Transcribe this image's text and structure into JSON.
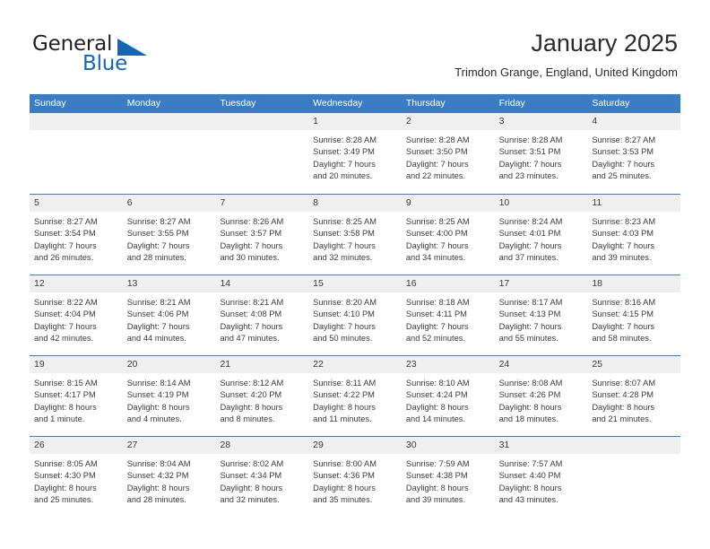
{
  "brand": {
    "word_one": "General",
    "word_two": "Blue",
    "triangle_icon": "brand-triangle-icon",
    "accent_color": "#1567b2"
  },
  "header": {
    "title": "January 2025",
    "subtitle": "Trimdon Grange, England, United Kingdom"
  },
  "colors": {
    "header_blue": "#3b7dc4",
    "day_strip_gray": "#efefef",
    "text": "#3a3a3a"
  },
  "calendar": {
    "weekdays": [
      "Sunday",
      "Monday",
      "Tuesday",
      "Wednesday",
      "Thursday",
      "Friday",
      "Saturday"
    ],
    "weeks": [
      [
        {
          "day": "",
          "empty": true,
          "lines": []
        },
        {
          "day": "",
          "empty": true,
          "lines": []
        },
        {
          "day": "",
          "empty": true,
          "lines": []
        },
        {
          "day": "1",
          "empty": false,
          "lines": [
            "Sunrise: 8:28 AM",
            "Sunset: 3:49 PM",
            "Daylight: 7 hours",
            "and 20 minutes."
          ]
        },
        {
          "day": "2",
          "empty": false,
          "lines": [
            "Sunrise: 8:28 AM",
            "Sunset: 3:50 PM",
            "Daylight: 7 hours",
            "and 22 minutes."
          ]
        },
        {
          "day": "3",
          "empty": false,
          "lines": [
            "Sunrise: 8:28 AM",
            "Sunset: 3:51 PM",
            "Daylight: 7 hours",
            "and 23 minutes."
          ]
        },
        {
          "day": "4",
          "empty": false,
          "lines": [
            "Sunrise: 8:27 AM",
            "Sunset: 3:53 PM",
            "Daylight: 7 hours",
            "and 25 minutes."
          ]
        }
      ],
      [
        {
          "day": "5",
          "empty": false,
          "lines": [
            "Sunrise: 8:27 AM",
            "Sunset: 3:54 PM",
            "Daylight: 7 hours",
            "and 26 minutes."
          ]
        },
        {
          "day": "6",
          "empty": false,
          "lines": [
            "Sunrise: 8:27 AM",
            "Sunset: 3:55 PM",
            "Daylight: 7 hours",
            "and 28 minutes."
          ]
        },
        {
          "day": "7",
          "empty": false,
          "lines": [
            "Sunrise: 8:26 AM",
            "Sunset: 3:57 PM",
            "Daylight: 7 hours",
            "and 30 minutes."
          ]
        },
        {
          "day": "8",
          "empty": false,
          "lines": [
            "Sunrise: 8:25 AM",
            "Sunset: 3:58 PM",
            "Daylight: 7 hours",
            "and 32 minutes."
          ]
        },
        {
          "day": "9",
          "empty": false,
          "lines": [
            "Sunrise: 8:25 AM",
            "Sunset: 4:00 PM",
            "Daylight: 7 hours",
            "and 34 minutes."
          ]
        },
        {
          "day": "10",
          "empty": false,
          "lines": [
            "Sunrise: 8:24 AM",
            "Sunset: 4:01 PM",
            "Daylight: 7 hours",
            "and 37 minutes."
          ]
        },
        {
          "day": "11",
          "empty": false,
          "lines": [
            "Sunrise: 8:23 AM",
            "Sunset: 4:03 PM",
            "Daylight: 7 hours",
            "and 39 minutes."
          ]
        }
      ],
      [
        {
          "day": "12",
          "empty": false,
          "lines": [
            "Sunrise: 8:22 AM",
            "Sunset: 4:04 PM",
            "Daylight: 7 hours",
            "and 42 minutes."
          ]
        },
        {
          "day": "13",
          "empty": false,
          "lines": [
            "Sunrise: 8:21 AM",
            "Sunset: 4:06 PM",
            "Daylight: 7 hours",
            "and 44 minutes."
          ]
        },
        {
          "day": "14",
          "empty": false,
          "lines": [
            "Sunrise: 8:21 AM",
            "Sunset: 4:08 PM",
            "Daylight: 7 hours",
            "and 47 minutes."
          ]
        },
        {
          "day": "15",
          "empty": false,
          "lines": [
            "Sunrise: 8:20 AM",
            "Sunset: 4:10 PM",
            "Daylight: 7 hours",
            "and 50 minutes."
          ]
        },
        {
          "day": "16",
          "empty": false,
          "lines": [
            "Sunrise: 8:18 AM",
            "Sunset: 4:11 PM",
            "Daylight: 7 hours",
            "and 52 minutes."
          ]
        },
        {
          "day": "17",
          "empty": false,
          "lines": [
            "Sunrise: 8:17 AM",
            "Sunset: 4:13 PM",
            "Daylight: 7 hours",
            "and 55 minutes."
          ]
        },
        {
          "day": "18",
          "empty": false,
          "lines": [
            "Sunrise: 8:16 AM",
            "Sunset: 4:15 PM",
            "Daylight: 7 hours",
            "and 58 minutes."
          ]
        }
      ],
      [
        {
          "day": "19",
          "empty": false,
          "lines": [
            "Sunrise: 8:15 AM",
            "Sunset: 4:17 PM",
            "Daylight: 8 hours",
            "and 1 minute."
          ]
        },
        {
          "day": "20",
          "empty": false,
          "lines": [
            "Sunrise: 8:14 AM",
            "Sunset: 4:19 PM",
            "Daylight: 8 hours",
            "and 4 minutes."
          ]
        },
        {
          "day": "21",
          "empty": false,
          "lines": [
            "Sunrise: 8:12 AM",
            "Sunset: 4:20 PM",
            "Daylight: 8 hours",
            "and 8 minutes."
          ]
        },
        {
          "day": "22",
          "empty": false,
          "lines": [
            "Sunrise: 8:11 AM",
            "Sunset: 4:22 PM",
            "Daylight: 8 hours",
            "and 11 minutes."
          ]
        },
        {
          "day": "23",
          "empty": false,
          "lines": [
            "Sunrise: 8:10 AM",
            "Sunset: 4:24 PM",
            "Daylight: 8 hours",
            "and 14 minutes."
          ]
        },
        {
          "day": "24",
          "empty": false,
          "lines": [
            "Sunrise: 8:08 AM",
            "Sunset: 4:26 PM",
            "Daylight: 8 hours",
            "and 18 minutes."
          ]
        },
        {
          "day": "25",
          "empty": false,
          "lines": [
            "Sunrise: 8:07 AM",
            "Sunset: 4:28 PM",
            "Daylight: 8 hours",
            "and 21 minutes."
          ]
        }
      ],
      [
        {
          "day": "26",
          "empty": false,
          "lines": [
            "Sunrise: 8:05 AM",
            "Sunset: 4:30 PM",
            "Daylight: 8 hours",
            "and 25 minutes."
          ]
        },
        {
          "day": "27",
          "empty": false,
          "lines": [
            "Sunrise: 8:04 AM",
            "Sunset: 4:32 PM",
            "Daylight: 8 hours",
            "and 28 minutes."
          ]
        },
        {
          "day": "28",
          "empty": false,
          "lines": [
            "Sunrise: 8:02 AM",
            "Sunset: 4:34 PM",
            "Daylight: 8 hours",
            "and 32 minutes."
          ]
        },
        {
          "day": "29",
          "empty": false,
          "lines": [
            "Sunrise: 8:00 AM",
            "Sunset: 4:36 PM",
            "Daylight: 8 hours",
            "and 35 minutes."
          ]
        },
        {
          "day": "30",
          "empty": false,
          "lines": [
            "Sunrise: 7:59 AM",
            "Sunset: 4:38 PM",
            "Daylight: 8 hours",
            "and 39 minutes."
          ]
        },
        {
          "day": "31",
          "empty": false,
          "lines": [
            "Sunrise: 7:57 AM",
            "Sunset: 4:40 PM",
            "Daylight: 8 hours",
            "and 43 minutes."
          ]
        },
        {
          "day": "",
          "empty": true,
          "lines": []
        }
      ]
    ]
  }
}
